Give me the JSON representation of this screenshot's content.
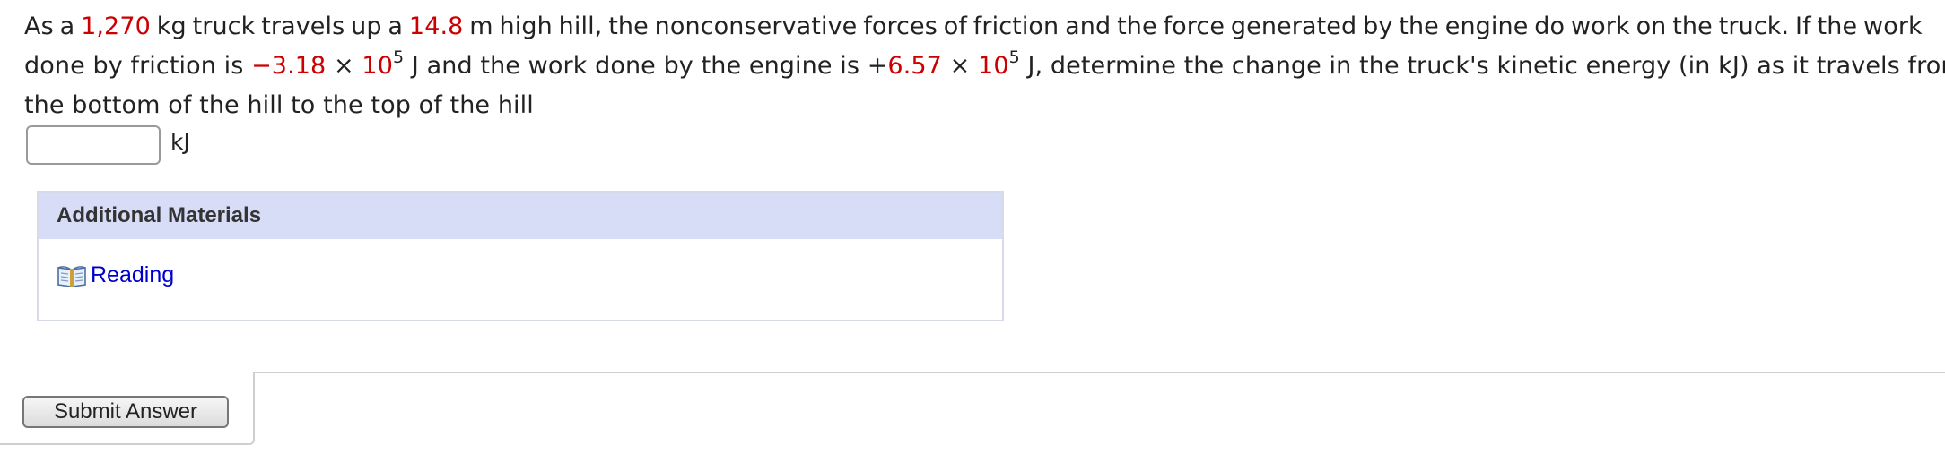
{
  "question": {
    "line1_words": [
      "As",
      "a",
      "1,270",
      "kg",
      "truck",
      "travels",
      "up",
      "a",
      "14.8",
      "m",
      "high",
      "hill,",
      "the",
      "nonconservative",
      "forces",
      "of",
      "friction",
      "and",
      "the",
      "force",
      "generated",
      "by",
      "the",
      "engine",
      "do",
      "work",
      "on",
      "the",
      "truck.",
      "If",
      "the",
      "work"
    ],
    "mass_value": "1,270",
    "height_value": "14.8",
    "line2": {
      "seg1": "done by friction is ",
      "friction_value": "−3.18",
      "times1": " × ",
      "base1": "10",
      "exp1": "5",
      "seg2": " J and the work done by the engine is ",
      "plus_sign": "+",
      "engine_value": "6.57",
      "times2": " × ",
      "base2": "10",
      "exp2": "5",
      "seg3": " J, determine the change in the truck's kinetic energy (in kJ) as it travels from"
    },
    "line3": "the bottom of the hill to the top of the hill"
  },
  "answer": {
    "value": "",
    "unit": "kJ"
  },
  "additional_materials": {
    "title": "Additional Materials",
    "link_label": "Reading",
    "icon": "book-icon"
  },
  "submit": {
    "label": "Submit Answer"
  },
  "colors": {
    "highlight": "#cc0000",
    "link": "#0000cc",
    "panel_header": "#d7ddf7"
  }
}
